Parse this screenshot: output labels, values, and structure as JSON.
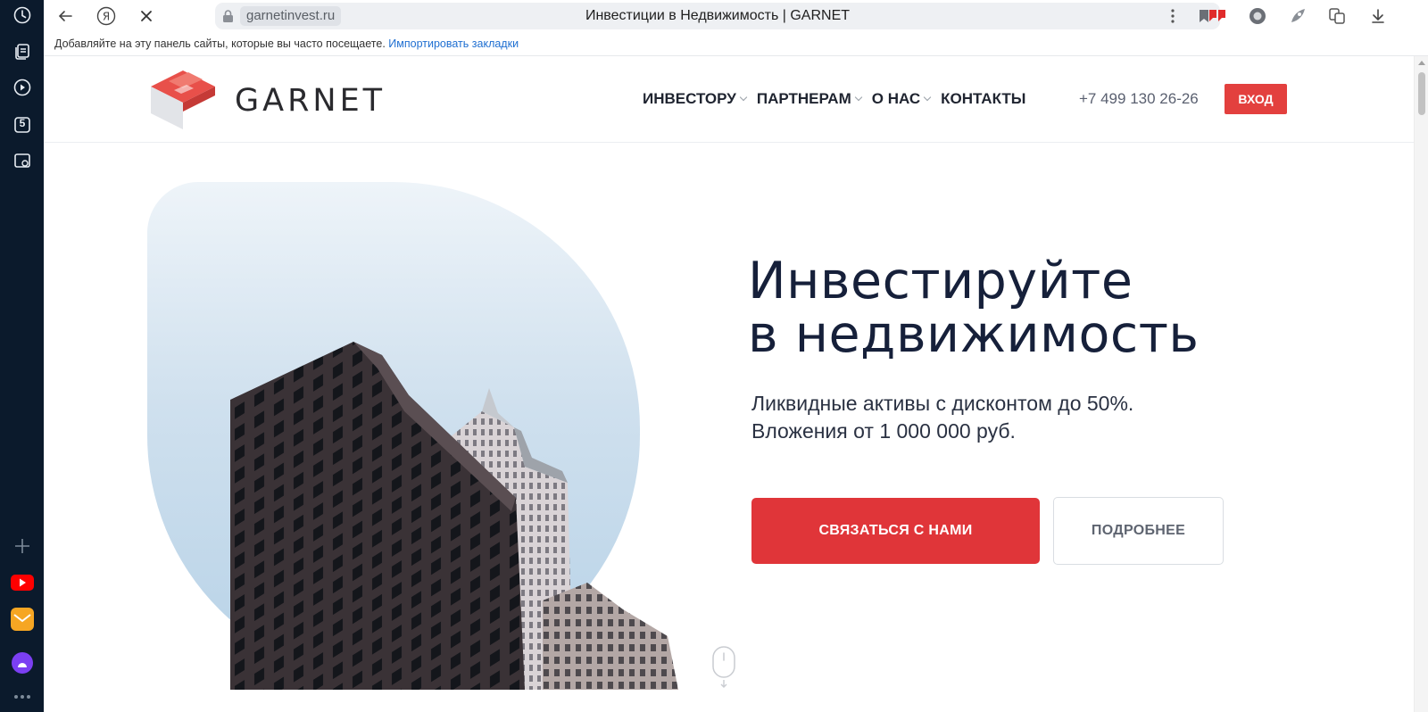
{
  "browser": {
    "url": "garnetinvest.ru",
    "tab_title": "Инвестиции в Недвижимость | GARNET",
    "bookmarks_hint": "Добавляйте на эту панель сайты, которые вы часто посещаете.",
    "bookmarks_import": "Импортировать закладки",
    "side_panel_badge": "5"
  },
  "site": {
    "brand": "GARNET",
    "nav": [
      {
        "label": "ИНВЕСТОРУ",
        "has_dropdown": true
      },
      {
        "label": "ПАРТНЕРАМ",
        "has_dropdown": true
      },
      {
        "label": "О НАС",
        "has_dropdown": true
      },
      {
        "label": "КОНТАКТЫ",
        "has_dropdown": false
      }
    ],
    "phone": "+7 499 130 26-26",
    "login_label": "ВХОД",
    "hero": {
      "title_line1": "Инвестируйте",
      "title_line2": "в недвижимость",
      "subtitle_line1": "Ликвидные активы с дисконтом до 50%.",
      "subtitle_line2": "Вложения от 1 000 000 руб.",
      "primary_cta": "СВЯЗАТЬСЯ С НАМИ",
      "secondary_cta": "ПОДРОБНЕЕ"
    }
  },
  "colors": {
    "accent": "#e03539",
    "side_panel_bg": "#0b1a2c",
    "heading": "#16203a"
  }
}
